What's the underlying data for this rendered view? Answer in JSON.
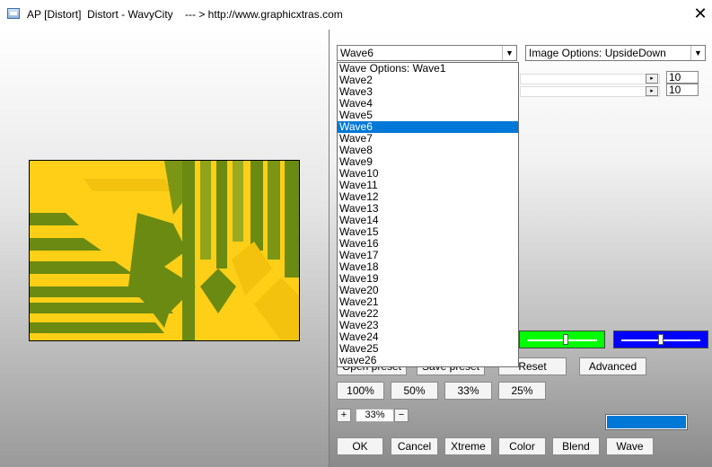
{
  "window": {
    "title": "AP [Distort]  Distort - WavyCity    --- > http://www.graphicxtras.com"
  },
  "wave_select": {
    "value": "Wave6"
  },
  "image_options_select": {
    "value": "Image Options: UpsideDown"
  },
  "wave_list": {
    "items": [
      "Wave Options: Wave1",
      "Wave2",
      "Wave3",
      "Wave4",
      "Wave5",
      "Wave6",
      "Wave7",
      "Wave8",
      "Wave9",
      "Wave10",
      "Wave11",
      "Wave12",
      "Wave13",
      "Wave14",
      "Wave15",
      "Wave16",
      "Wave17",
      "Wave18",
      "Wave19",
      "Wave20",
      "Wave21",
      "Wave22",
      "Wave23",
      "Wave24",
      "Wave25",
      "wave26"
    ],
    "selected_index": 5
  },
  "params": {
    "value1": "10",
    "value2": "10"
  },
  "color_sliders": {
    "green": {
      "color": "#00ff00",
      "level": 0.55
    },
    "blue": {
      "color": "#0000ff",
      "level": 0.5
    }
  },
  "buttons": {
    "open_preset": "Open preset",
    "save_preset": "Save preset",
    "reset": "Reset",
    "advanced": "Advanced",
    "zoom_100": "100%",
    "zoom_50": "50%",
    "zoom_33": "33%",
    "zoom_25": "25%",
    "zoom_in": "+",
    "zoom_out": "−",
    "ok": "OK",
    "cancel": "Cancel",
    "xtreme": "Xtreme",
    "color": "Color",
    "blend": "Blend",
    "wave": "Wave"
  },
  "zoom": {
    "value": "33%"
  },
  "colors": {
    "preview_yellow": "#fecf16",
    "preview_green": "#6b8a12",
    "selection": "#0078d7",
    "swatch": "#0078d7"
  }
}
